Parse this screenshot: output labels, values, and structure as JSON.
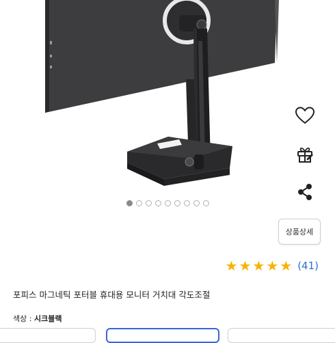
{
  "product": {
    "title": "포피스 마그네틱 포터블 휴대용 모니터 거치대 각도조절",
    "detail_button_label": "상품상세",
    "rating": {
      "stars": 5,
      "count_label": "(41)"
    },
    "option": {
      "label": "색상 : ",
      "value": "시크블랙"
    }
  },
  "gallery": {
    "total": 9,
    "active_index": 1
  },
  "side_actions": [
    "heart-icon",
    "gift-icon",
    "share-icon"
  ],
  "colors": {
    "star": "#f5b400",
    "link": "#2f6fd8",
    "selected_border": "#3a64d8"
  }
}
